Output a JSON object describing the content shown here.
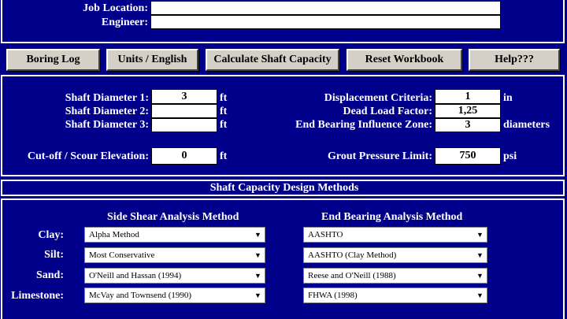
{
  "header": {
    "job_location_label": "Job Location:",
    "engineer_label": "Engineer:",
    "job_location_value": "",
    "engineer_value": ""
  },
  "toolbar": {
    "boring_log": "Boring Log",
    "units": "Units / English",
    "calculate": "Calculate Shaft Capacity",
    "reset": "Reset Workbook",
    "help": "Help???"
  },
  "inputs": {
    "shaft_diameter_1_label": "Shaft Diameter 1:",
    "shaft_diameter_1_value": "3",
    "shaft_diameter_2_label": "Shaft Diameter 2:",
    "shaft_diameter_2_value": "",
    "shaft_diameter_3_label": "Shaft Diameter 3:",
    "shaft_diameter_3_value": "",
    "cutoff_label": "Cut-off / Scour Elevation:",
    "cutoff_value": "0",
    "displacement_label": "Displacement Criteria:",
    "displacement_value": "1",
    "dead_load_label": "Dead Load Factor:",
    "dead_load_value": "1,25",
    "end_bearing_zone_label": "End Bearing Influence Zone:",
    "end_bearing_zone_value": "3",
    "grout_label": "Grout Pressure Limit:",
    "grout_value": "750",
    "unit_ft": "ft",
    "unit_in": "in",
    "unit_diameters": "diameters",
    "unit_psi": "psi"
  },
  "methods": {
    "section_title": "Shaft Capacity Design Methods",
    "side_shear_title": "Side Shear Analysis Method",
    "end_bearing_title": "End Bearing Analysis Method",
    "clay_label": "Clay:",
    "silt_label": "Silt:",
    "sand_label": "Sand:",
    "limestone_label": "Limestone:",
    "side_clay": "Alpha Method",
    "side_silt": "Most Conservative",
    "side_sand": "O'Neill and Hassan (1994)",
    "side_limestone": "McVay and Townsend (1990)",
    "end_clay": "AASHTO",
    "end_silt": "AASHTO (Clay Method)",
    "end_sand": "Reese and O'Neill (1988)",
    "end_limestone": "FHWA (1998)"
  },
  "icons": {
    "dropdown": "chevron-down-icon"
  },
  "colors": {
    "background": "#00008b",
    "button_face": "#d4d0c8",
    "text": "#ffffff"
  }
}
